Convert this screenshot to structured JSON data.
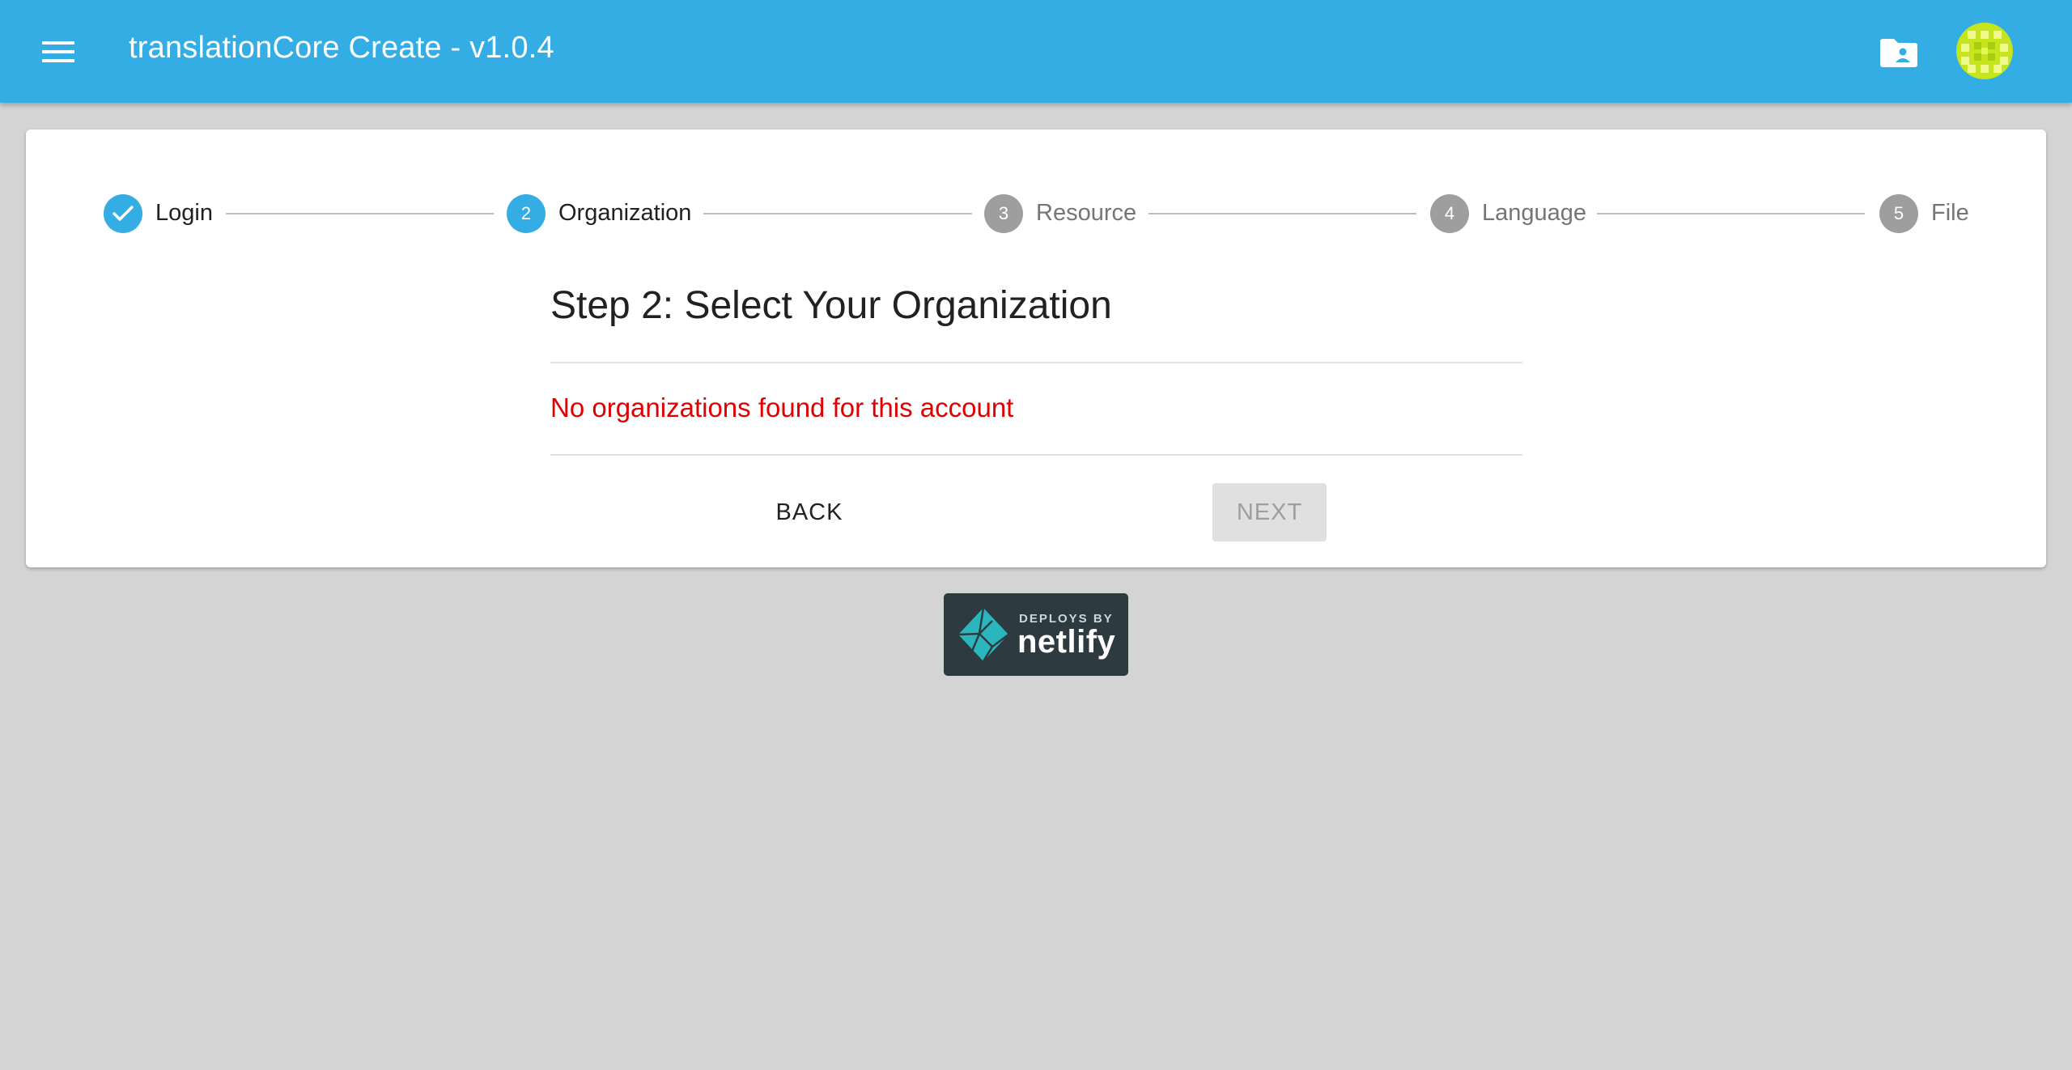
{
  "appbar": {
    "title": "translationCore Create - v1.0.4",
    "background": "#33ade3"
  },
  "stepper": {
    "steps": [
      {
        "number": "",
        "label": "Login",
        "state": "completed"
      },
      {
        "number": "2",
        "label": "Organization",
        "state": "active"
      },
      {
        "number": "3",
        "label": "Resource",
        "state": "inactive"
      },
      {
        "number": "4",
        "label": "Language",
        "state": "inactive"
      },
      {
        "number": "5",
        "label": "File",
        "state": "inactive"
      }
    ]
  },
  "main": {
    "title": "Step 2: Select Your Organization",
    "error_message": "No organizations found for this account",
    "error_color": "#e10000",
    "back_label": "BACK",
    "next_label": "NEXT"
  },
  "footer": {
    "badge_small": "DEPLOYS BY",
    "badge_big": "netlify"
  },
  "icons": {
    "menu": "menu-icon",
    "folder": "folder-account-icon",
    "avatar": "identicon-avatar",
    "check": "check-icon",
    "netlify_logo": "netlify-logo"
  }
}
